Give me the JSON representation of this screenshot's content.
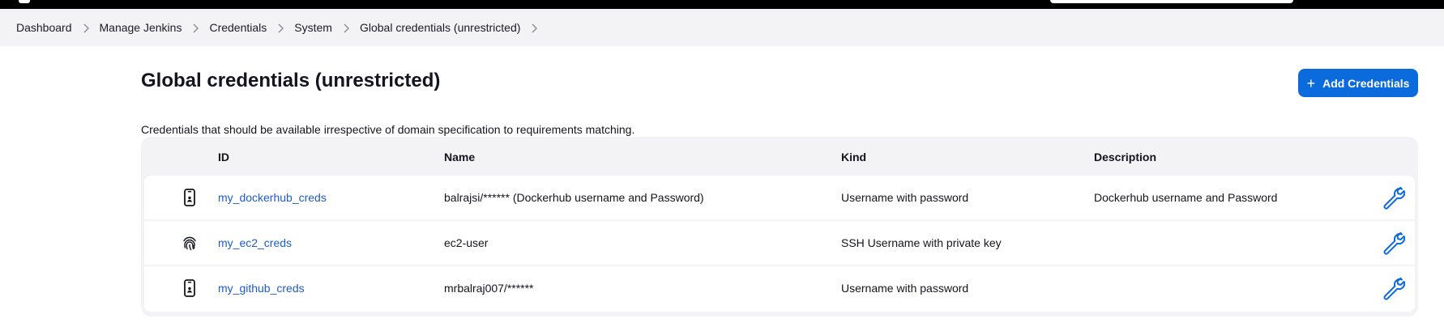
{
  "breadcrumb": [
    "Dashboard",
    "Manage Jenkins",
    "Credentials",
    "System",
    "Global credentials (unrestricted)"
  ],
  "page": {
    "title": "Global credentials (unrestricted)",
    "description": "Credentials that should be available irrespective of domain specification to requirements matching.",
    "add_button_label": "Add Credentials"
  },
  "table": {
    "headers": {
      "id": "ID",
      "name": "Name",
      "kind": "Kind",
      "description": "Description"
    },
    "rows": [
      {
        "icon": "mobile-phone-icon",
        "id": "my_dockerhub_creds",
        "name": "balrajsi/****** (Dockerhub username and Password)",
        "kind": "Username with password",
        "description": "Dockerhub username and Password"
      },
      {
        "icon": "fingerprint-icon",
        "id": "my_ec2_creds",
        "name": "ec2-user",
        "kind": "SSH Username with private key",
        "description": ""
      },
      {
        "icon": "mobile-phone-icon",
        "id": "my_github_creds",
        "name": "mrbalraj007/******",
        "kind": "Username with password",
        "description": ""
      }
    ]
  },
  "colors": {
    "accent": "#0b6bdc",
    "link": "#1d5cc7",
    "panel": "#f3f3f6",
    "topbar": "#000000"
  }
}
